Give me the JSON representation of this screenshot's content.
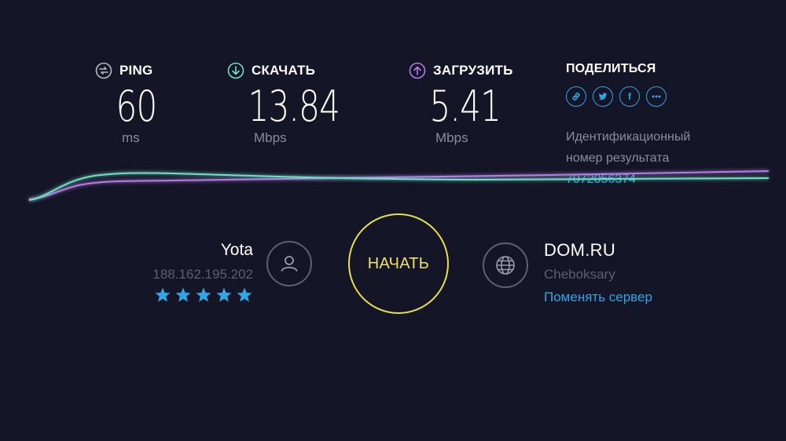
{
  "metrics": {
    "ping": {
      "label": "PING",
      "value": "60",
      "unit": "ms",
      "icon": "ping-icon",
      "color": "#b9bac6"
    },
    "download": {
      "label": "СКАЧАТЬ",
      "value": "13.84",
      "unit": "Mbps",
      "icon": "download-arrow-icon",
      "color": "#6fe0c8"
    },
    "upload": {
      "label": "ЗАГРУЗИТЬ",
      "value": "5.41",
      "unit": "Mbps",
      "icon": "upload-arrow-icon",
      "color": "#b77be6"
    }
  },
  "share": {
    "title": "ПОДЕЛИТЬСЯ",
    "icons": [
      "link-icon",
      "twitter-icon",
      "facebook-icon",
      "more-icon"
    ],
    "facebook_glyph": "f",
    "result_label_line1": "Идентификационный",
    "result_label_line2": "номер результата",
    "result_id": "7072056374"
  },
  "isp": {
    "name": "Yota",
    "ip": "188.162.195.202",
    "rating": 5,
    "star_color": "#2fa6e6"
  },
  "start": {
    "label": "НАЧАТЬ",
    "color": "#e8e24a"
  },
  "server": {
    "name": "DOM.RU",
    "city": "Cheboksary",
    "change_label": "Поменять сервер"
  },
  "colors": {
    "background": "#141526",
    "accent": "#2fa6e6",
    "download_line": "#6fe0c8",
    "upload_line": "#b77be6",
    "muted": "#8b8d9e"
  }
}
